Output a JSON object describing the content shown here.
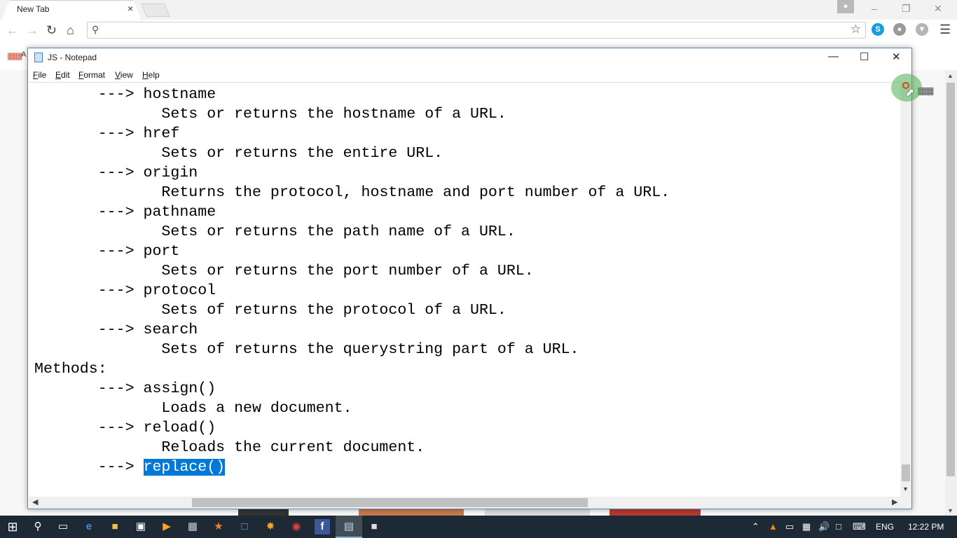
{
  "browser": {
    "tab_title": "New Tab",
    "tab_close": "×",
    "profile_icon": "person-icon",
    "win_minimize": "–",
    "win_restore": "❐",
    "win_close": "✕",
    "apps_label": "A"
  },
  "notepad": {
    "title": "JS - Notepad",
    "menus": [
      {
        "key": "F",
        "rest": "ile"
      },
      {
        "key": "E",
        "rest": "dit"
      },
      {
        "key": "F",
        "rest": "ormat"
      },
      {
        "key": "V",
        "rest": "iew"
      },
      {
        "key": "H",
        "rest": "elp"
      }
    ],
    "minimize": "—",
    "maximize": "☐",
    "close": "✕",
    "lines": [
      "       ---> hostname",
      "              Sets or returns the hostname of a URL.",
      "       ---> href",
      "              Sets or returns the entire URL.",
      "       ---> origin",
      "              Returns the protocol, hostname and port number of a URL.",
      "       ---> pathname",
      "              Sets or returns the path name of a URL.",
      "       ---> port",
      "              Sets or returns the port number of a URL.",
      "       ---> protocol",
      "              Sets of returns the protocol of a URL.",
      "       ---> search",
      "              Sets of returns the querystring part of a URL.",
      "Methods:",
      "       ---> assign()",
      "              Loads a new document.",
      "       ---> reload()",
      "              Reloads the current document."
    ],
    "last_line_prefix": "       ---> ",
    "selected_text": "replace()"
  },
  "taskbar": {
    "language": "ENG",
    "time": "12:22 PM",
    "accent_color": "#7fb7e8"
  },
  "colors": {
    "selection": "#0078d7",
    "notepad_border": "#5a87c2",
    "taskbar": "#1d2a35"
  }
}
